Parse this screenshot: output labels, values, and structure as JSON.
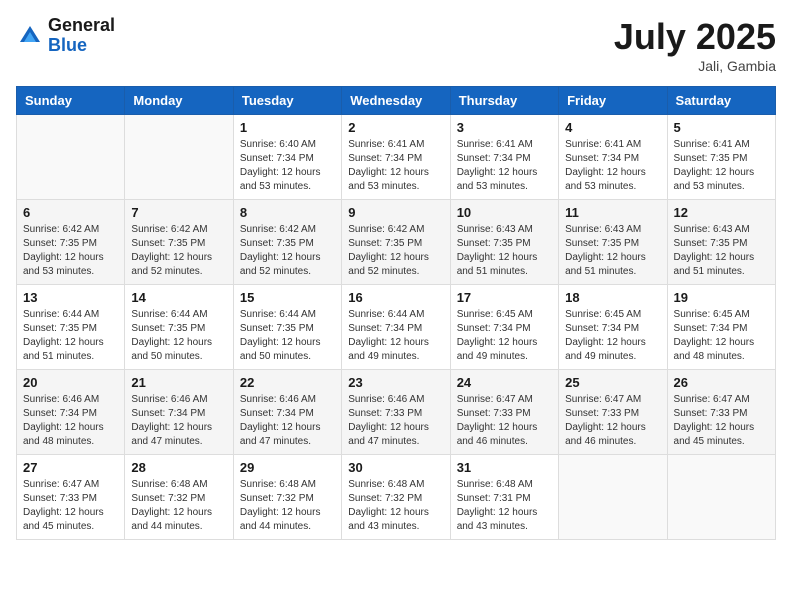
{
  "logo": {
    "text_general": "General",
    "text_blue": "Blue"
  },
  "title": "July 2025",
  "location": "Jali, Gambia",
  "days_of_week": [
    "Sunday",
    "Monday",
    "Tuesday",
    "Wednesday",
    "Thursday",
    "Friday",
    "Saturday"
  ],
  "weeks": [
    [
      {
        "day": "",
        "info": ""
      },
      {
        "day": "",
        "info": ""
      },
      {
        "day": "1",
        "info": "Sunrise: 6:40 AM\nSunset: 7:34 PM\nDaylight: 12 hours\nand 53 minutes."
      },
      {
        "day": "2",
        "info": "Sunrise: 6:41 AM\nSunset: 7:34 PM\nDaylight: 12 hours\nand 53 minutes."
      },
      {
        "day": "3",
        "info": "Sunrise: 6:41 AM\nSunset: 7:34 PM\nDaylight: 12 hours\nand 53 minutes."
      },
      {
        "day": "4",
        "info": "Sunrise: 6:41 AM\nSunset: 7:34 PM\nDaylight: 12 hours\nand 53 minutes."
      },
      {
        "day": "5",
        "info": "Sunrise: 6:41 AM\nSunset: 7:35 PM\nDaylight: 12 hours\nand 53 minutes."
      }
    ],
    [
      {
        "day": "6",
        "info": "Sunrise: 6:42 AM\nSunset: 7:35 PM\nDaylight: 12 hours\nand 53 minutes."
      },
      {
        "day": "7",
        "info": "Sunrise: 6:42 AM\nSunset: 7:35 PM\nDaylight: 12 hours\nand 52 minutes."
      },
      {
        "day": "8",
        "info": "Sunrise: 6:42 AM\nSunset: 7:35 PM\nDaylight: 12 hours\nand 52 minutes."
      },
      {
        "day": "9",
        "info": "Sunrise: 6:42 AM\nSunset: 7:35 PM\nDaylight: 12 hours\nand 52 minutes."
      },
      {
        "day": "10",
        "info": "Sunrise: 6:43 AM\nSunset: 7:35 PM\nDaylight: 12 hours\nand 51 minutes."
      },
      {
        "day": "11",
        "info": "Sunrise: 6:43 AM\nSunset: 7:35 PM\nDaylight: 12 hours\nand 51 minutes."
      },
      {
        "day": "12",
        "info": "Sunrise: 6:43 AM\nSunset: 7:35 PM\nDaylight: 12 hours\nand 51 minutes."
      }
    ],
    [
      {
        "day": "13",
        "info": "Sunrise: 6:44 AM\nSunset: 7:35 PM\nDaylight: 12 hours\nand 51 minutes."
      },
      {
        "day": "14",
        "info": "Sunrise: 6:44 AM\nSunset: 7:35 PM\nDaylight: 12 hours\nand 50 minutes."
      },
      {
        "day": "15",
        "info": "Sunrise: 6:44 AM\nSunset: 7:35 PM\nDaylight: 12 hours\nand 50 minutes."
      },
      {
        "day": "16",
        "info": "Sunrise: 6:44 AM\nSunset: 7:34 PM\nDaylight: 12 hours\nand 49 minutes."
      },
      {
        "day": "17",
        "info": "Sunrise: 6:45 AM\nSunset: 7:34 PM\nDaylight: 12 hours\nand 49 minutes."
      },
      {
        "day": "18",
        "info": "Sunrise: 6:45 AM\nSunset: 7:34 PM\nDaylight: 12 hours\nand 49 minutes."
      },
      {
        "day": "19",
        "info": "Sunrise: 6:45 AM\nSunset: 7:34 PM\nDaylight: 12 hours\nand 48 minutes."
      }
    ],
    [
      {
        "day": "20",
        "info": "Sunrise: 6:46 AM\nSunset: 7:34 PM\nDaylight: 12 hours\nand 48 minutes."
      },
      {
        "day": "21",
        "info": "Sunrise: 6:46 AM\nSunset: 7:34 PM\nDaylight: 12 hours\nand 47 minutes."
      },
      {
        "day": "22",
        "info": "Sunrise: 6:46 AM\nSunset: 7:34 PM\nDaylight: 12 hours\nand 47 minutes."
      },
      {
        "day": "23",
        "info": "Sunrise: 6:46 AM\nSunset: 7:33 PM\nDaylight: 12 hours\nand 47 minutes."
      },
      {
        "day": "24",
        "info": "Sunrise: 6:47 AM\nSunset: 7:33 PM\nDaylight: 12 hours\nand 46 minutes."
      },
      {
        "day": "25",
        "info": "Sunrise: 6:47 AM\nSunset: 7:33 PM\nDaylight: 12 hours\nand 46 minutes."
      },
      {
        "day": "26",
        "info": "Sunrise: 6:47 AM\nSunset: 7:33 PM\nDaylight: 12 hours\nand 45 minutes."
      }
    ],
    [
      {
        "day": "27",
        "info": "Sunrise: 6:47 AM\nSunset: 7:33 PM\nDaylight: 12 hours\nand 45 minutes."
      },
      {
        "day": "28",
        "info": "Sunrise: 6:48 AM\nSunset: 7:32 PM\nDaylight: 12 hours\nand 44 minutes."
      },
      {
        "day": "29",
        "info": "Sunrise: 6:48 AM\nSunset: 7:32 PM\nDaylight: 12 hours\nand 44 minutes."
      },
      {
        "day": "30",
        "info": "Sunrise: 6:48 AM\nSunset: 7:32 PM\nDaylight: 12 hours\nand 43 minutes."
      },
      {
        "day": "31",
        "info": "Sunrise: 6:48 AM\nSunset: 7:31 PM\nDaylight: 12 hours\nand 43 minutes."
      },
      {
        "day": "",
        "info": ""
      },
      {
        "day": "",
        "info": ""
      }
    ]
  ]
}
